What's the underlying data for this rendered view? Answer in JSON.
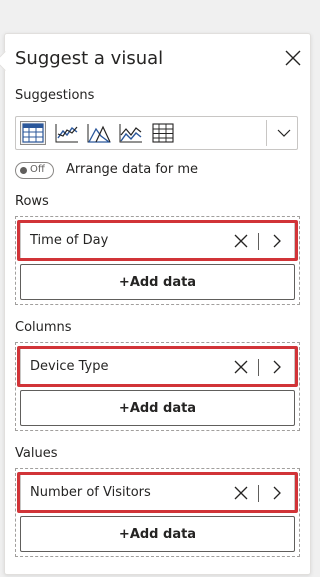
{
  "panel": {
    "title": "Suggest a visual",
    "close_icon": "close-icon"
  },
  "suggestions": {
    "label": "Suggestions",
    "icons": [
      "table-visual-icon",
      "line-chart-visual-icon",
      "area-chart-visual-icon",
      "stacked-area-visual-icon",
      "matrix-visual-icon"
    ],
    "selected_icon": "table-visual-icon",
    "dropdown_icon": "chevron-down-icon"
  },
  "arrange": {
    "toggle_state": "Off",
    "label": "Arrange data for me"
  },
  "wells": [
    {
      "label": "Rows",
      "field": "Time of Day",
      "add_label": "+Add data"
    },
    {
      "label": "Columns",
      "field": "Device Type",
      "add_label": "+Add data"
    },
    {
      "label": "Values",
      "field": "Number of Visitors",
      "add_label": "+Add data"
    }
  ],
  "colors": {
    "highlight": "#d13438",
    "text": "#252423",
    "accent_blue": "#2b579a"
  }
}
